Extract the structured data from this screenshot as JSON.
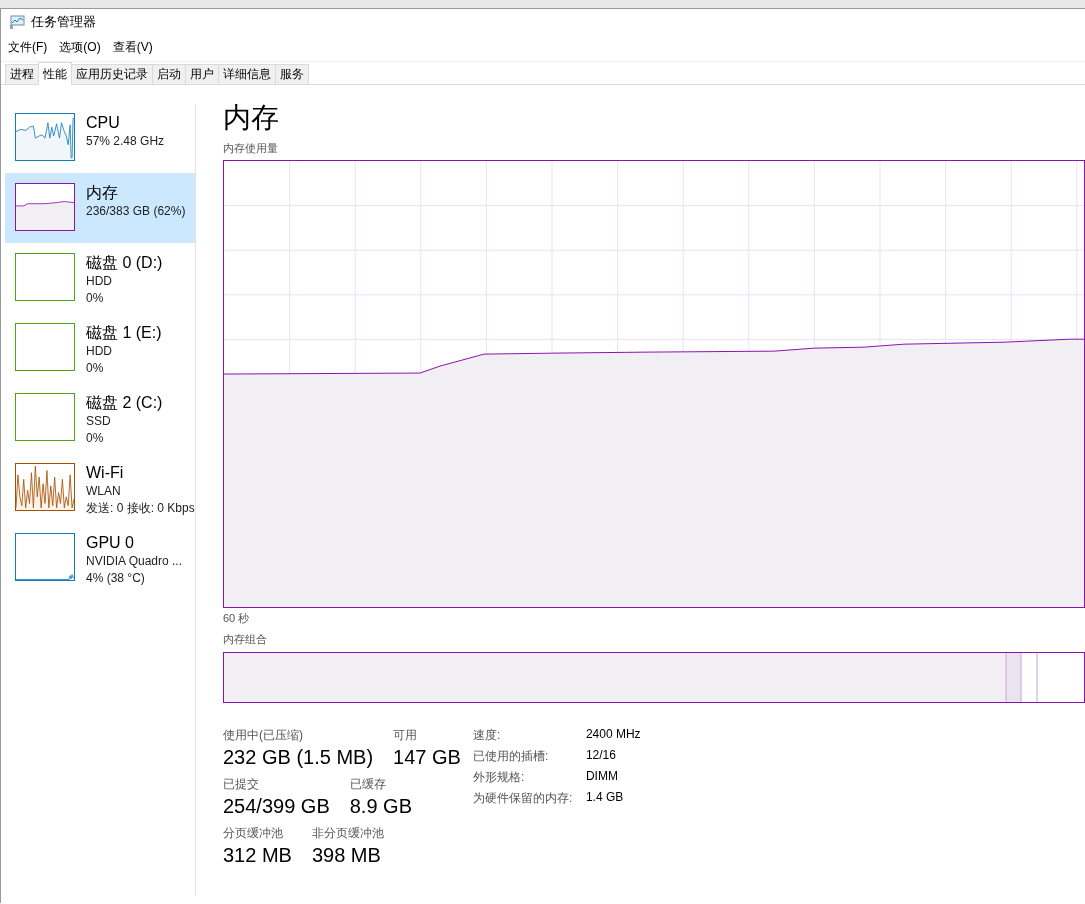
{
  "window": {
    "title": "任务管理器"
  },
  "menu": [
    {
      "label": "文件(F)"
    },
    {
      "label": "选项(O)"
    },
    {
      "label": "查看(V)"
    }
  ],
  "tabs": [
    {
      "label": "进程",
      "selected": false
    },
    {
      "label": "性能",
      "selected": true
    },
    {
      "label": "应用历史记录",
      "selected": false
    },
    {
      "label": "启动",
      "selected": false
    },
    {
      "label": "用户",
      "selected": false
    },
    {
      "label": "详细信息",
      "selected": false
    },
    {
      "label": "服务",
      "selected": false
    }
  ],
  "sidebar": {
    "items": [
      {
        "kind": "cpu",
        "name": "CPU",
        "lines": [
          "57% 2.48 GHz"
        ],
        "color": "#117dbb",
        "selected": false
      },
      {
        "kind": "memory",
        "name": "内存",
        "lines": [
          "236/383 GB (62%)"
        ],
        "color": "#8b12ae",
        "selected": true
      },
      {
        "kind": "disk",
        "name": "磁盘 0 (D:)",
        "lines": [
          "HDD",
          "0%"
        ],
        "color": "#4da60c",
        "selected": false
      },
      {
        "kind": "disk",
        "name": "磁盘 1 (E:)",
        "lines": [
          "HDD",
          "0%"
        ],
        "color": "#4da60c",
        "selected": false
      },
      {
        "kind": "disk",
        "name": "磁盘 2 (C:)",
        "lines": [
          "SSD",
          "0%"
        ],
        "color": "#4da60c",
        "selected": false
      },
      {
        "kind": "wifi",
        "name": "Wi-Fi",
        "lines": [
          "WLAN",
          "发送: 0 接收: 0 Kbps"
        ],
        "color": "#a74f01",
        "selected": false
      },
      {
        "kind": "gpu",
        "name": "GPU 0",
        "lines": [
          "NVIDIA Quadro ...",
          "4% (38 °C)"
        ],
        "color": "#117dbb",
        "selected": false
      }
    ]
  },
  "detail": {
    "title": "内存",
    "graph_label": "内存使用量",
    "time_label": "60 秒",
    "composition_label": "内存组合",
    "stat_rows": [
      {
        "stats": [
          {
            "label": "使用中(已压缩)",
            "value": "232 GB (1.5 MB)"
          },
          {
            "label": "可用",
            "value": "147 GB"
          }
        ]
      },
      {
        "stats": [
          {
            "label": "已提交",
            "value": "254/399 GB"
          },
          {
            "label": "已缓存",
            "value": "8.9 GB"
          }
        ]
      },
      {
        "stats": [
          {
            "label": "分页缓冲池",
            "value": "312 MB"
          },
          {
            "label": "非分页缓冲池",
            "value": "398 MB"
          }
        ]
      }
    ],
    "properties": [
      {
        "label": "速度:",
        "value": "2400 MHz"
      },
      {
        "label": "已使用的插槽:",
        "value": "12/16"
      },
      {
        "label": "外形规格:",
        "value": "DIMM"
      },
      {
        "label": "为硬件保留的内存:",
        "value": "1.4 GB"
      }
    ]
  }
}
